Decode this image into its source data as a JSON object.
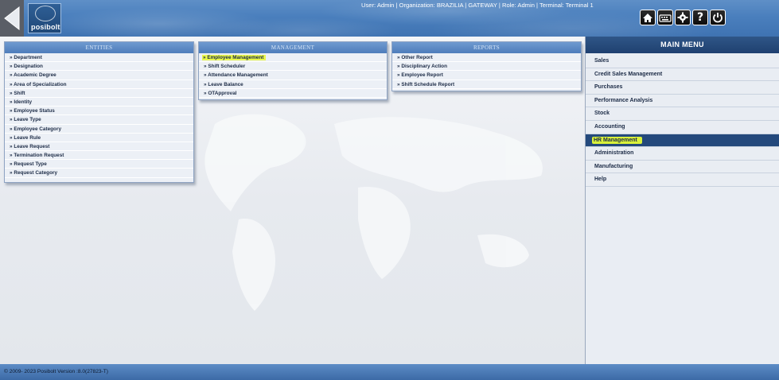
{
  "header": {
    "user_info": "User: Admin | Organization: BRAZILIA | GATEWAY | Role: Admin | Terminal: Terminal 1",
    "logo_text": "posibolt",
    "icons": [
      "home-icon",
      "keyboard-icon",
      "settings-icon",
      "help-icon",
      "power-icon"
    ]
  },
  "panels": {
    "entities": {
      "title": "ENTITIES",
      "items": [
        "» Department",
        "» Designation",
        "» Academic Degree",
        "» Area of Specialization",
        "» Shift",
        "» Identity",
        "» Employee Status",
        "» Leave Type",
        "» Employee Category",
        "» Leave Rule",
        "» Leave Request",
        "» Termination Request",
        "» Request Type",
        "» Request Category"
      ]
    },
    "management": {
      "title": "MANAGEMENT",
      "items": [
        "» Employee Management",
        "» Shift Scheduler",
        "» Attendance Management",
        "» Leave Balance",
        "» OTApproval"
      ],
      "highlighted": "» Employee Management"
    },
    "reports": {
      "title": "REPORTS",
      "items": [
        "» Other Report",
        "» Disciplinary Action",
        "» Employee Report",
        "» Shift Schedule Report"
      ]
    }
  },
  "main_menu": {
    "title": "MAIN MENU",
    "items": [
      "Sales",
      "Credit Sales Management",
      "Purchases",
      "Performance Analysis",
      "Stock",
      "Accounting",
      "HR Management",
      "Administration",
      "Manufacturing",
      "Help"
    ],
    "active": "HR Management"
  },
  "footer": {
    "text": "© 2009- 2023 Posibolt Version :8.0(27823-T)"
  },
  "colors": {
    "header_blue": "#4a7fbd",
    "menu_title": "#2f5687",
    "active_item": "#24497c",
    "highlight_yellow": "#e9f74b"
  }
}
